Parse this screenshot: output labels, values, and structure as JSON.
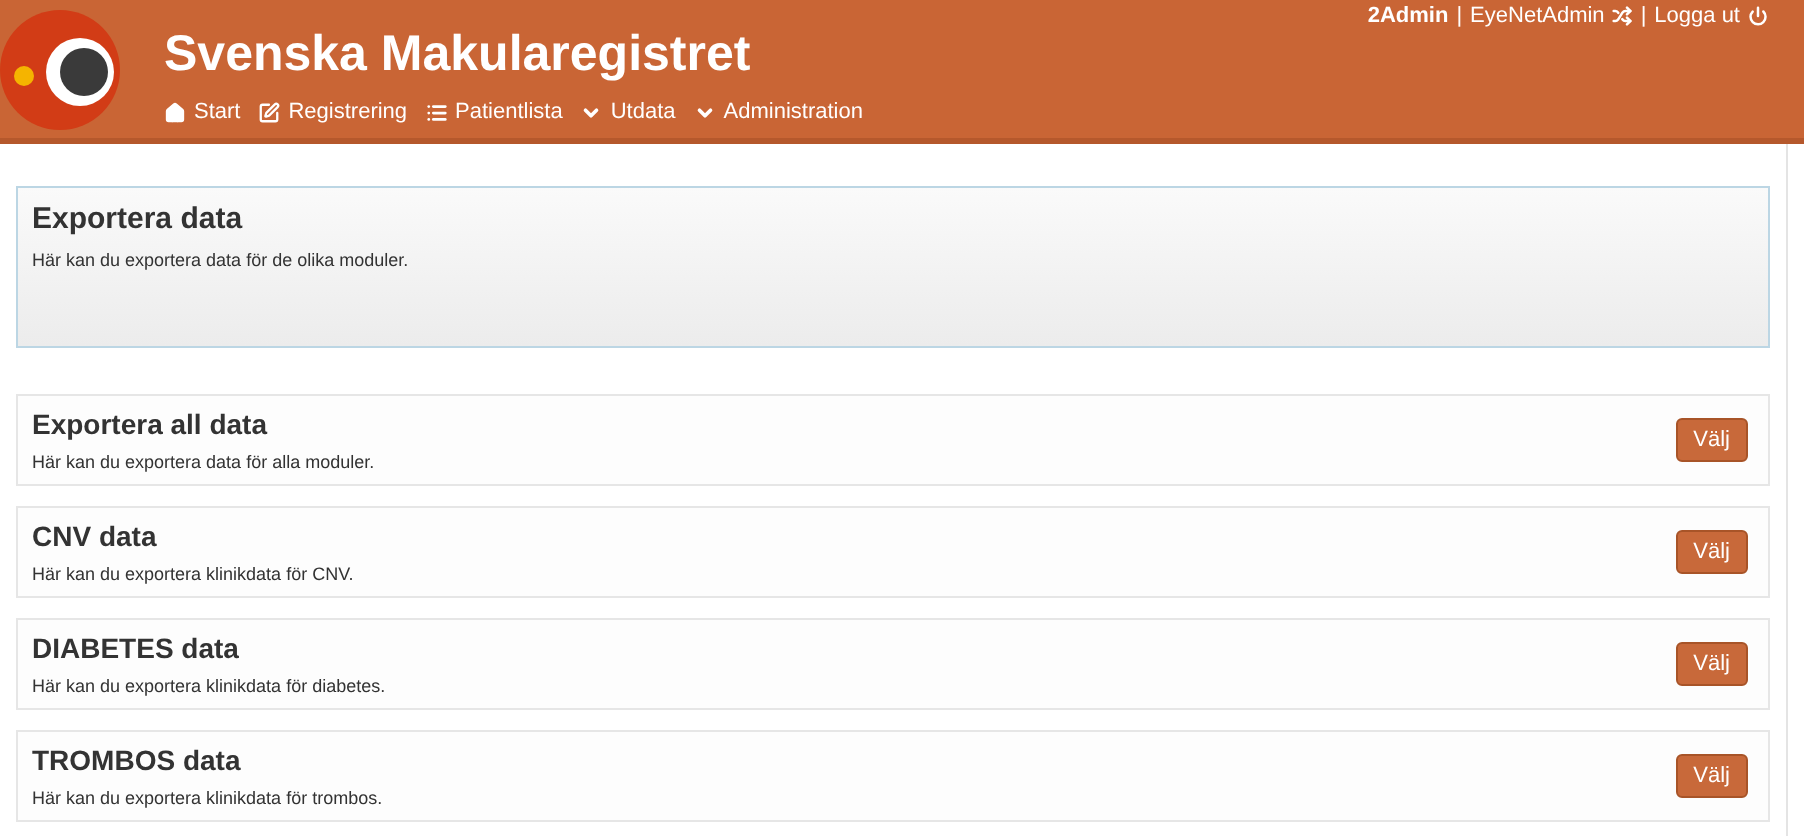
{
  "header": {
    "title": "Svenska Makularegistret",
    "nav": [
      {
        "label": "Start",
        "kind": "link"
      },
      {
        "label": "Registrering",
        "kind": "link"
      },
      {
        "label": "Patientlista",
        "kind": "link"
      },
      {
        "label": "Utdata",
        "kind": "dropdown"
      },
      {
        "label": "Administration",
        "kind": "dropdown"
      }
    ],
    "user": {
      "name": "2Admin",
      "separator_1": "|",
      "role": "EyeNetAdmin",
      "separator_2": "|",
      "logout": "Logga ut"
    }
  },
  "intro": {
    "title": "Exportera data",
    "text": "Här kan du exportera data för de olika moduler."
  },
  "exports": [
    {
      "title": "Exportera all data",
      "text": "Här kan du exportera data för alla moduler.",
      "button": "Välj"
    },
    {
      "title": "CNV data",
      "text": "Här kan du exportera klinikdata för CNV.",
      "button": "Välj"
    },
    {
      "title": "DIABETES data",
      "text": "Här kan du exportera klinikdata för diabetes.",
      "button": "Välj"
    },
    {
      "title": "TROMBOS data",
      "text": "Här kan du exportera klinikdata för trombos.",
      "button": "Välj"
    }
  ]
}
